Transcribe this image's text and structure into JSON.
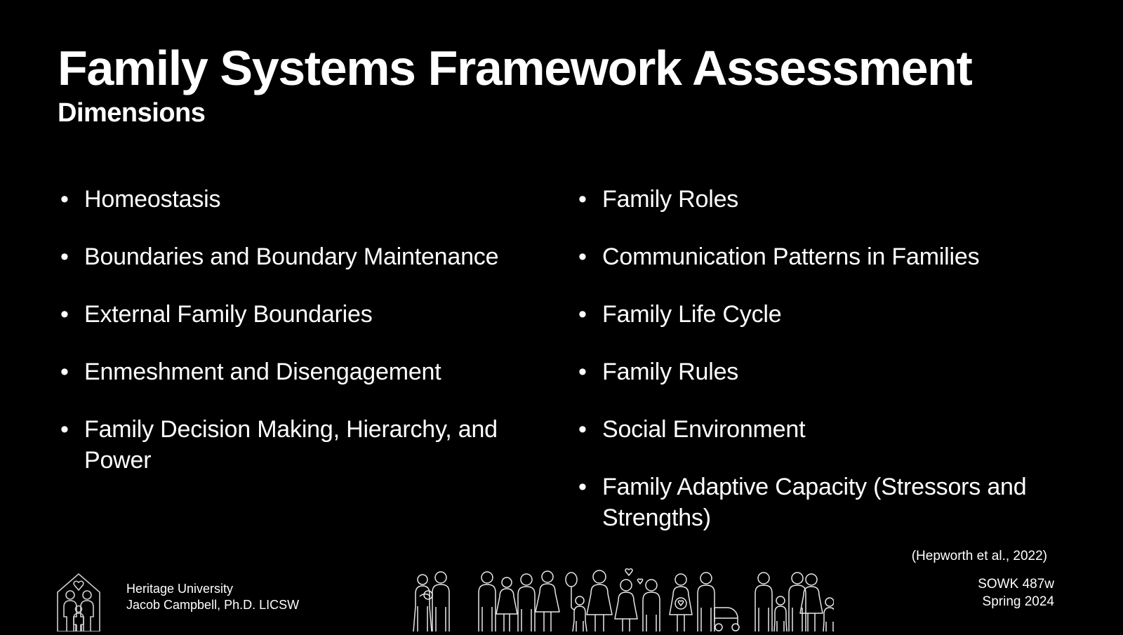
{
  "slide": {
    "background_color": "#000000",
    "text_color": "#ffffff",
    "title": "Family Systems Framework Assessment",
    "subtitle": "Dimensions"
  },
  "columns": {
    "left": [
      "Homeostasis",
      "Boundaries and Boundary Maintenance",
      "External Family Boundaries",
      "Enmeshment and Disengagement",
      "Family Decision Making, Hierarchy, and Power"
    ],
    "right": [
      "Family Roles",
      "Communication Patterns in Families",
      "Family Life Cycle",
      "Family Rules",
      "Social Environment",
      "Family Adaptive Capacity (Stressors and Strengths)"
    ],
    "bullet_glyph": "•"
  },
  "citation": "(Hepworth et al., 2022)",
  "footer": {
    "logo_icon": "house-family-heart-icon",
    "institution": "Heritage University",
    "presenter": "Jacob Campbell, Ph.D. LICSW",
    "course": "SOWK 487w",
    "term": "Spring 2024",
    "graphic_icon": "family-figures-row-icon"
  }
}
